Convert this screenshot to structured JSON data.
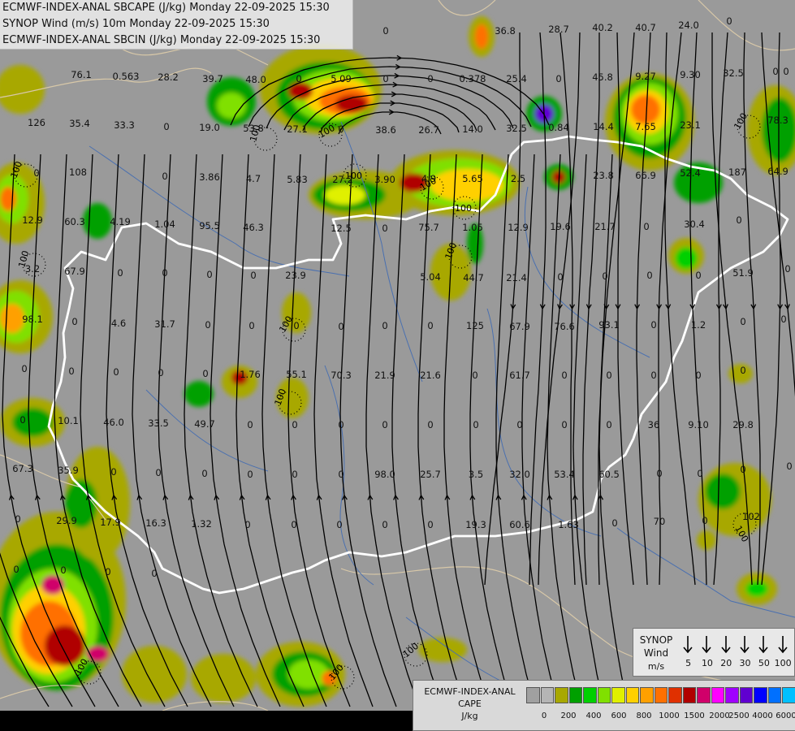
{
  "header": {
    "line1": "ECMWF-INDEX-ANAL SBCAPE (J/kg) Monday 22-09-2025 15:30",
    "line2": "SYNOP Wind (m/s) 10m Monday 22-09-2025 15:30",
    "line3": "ECMWF-INDEX-ANAL SBCIN (J/kg) Monday 22-09-2025 15:30"
  },
  "wind_legend": {
    "title_line1": "SYNOP",
    "title_line2": "Wind",
    "unit": "m/s",
    "values": [
      "5",
      "10",
      "20",
      "30",
      "50",
      "100"
    ]
  },
  "cape_legend": {
    "title_line1": "ECMWF-INDEX-ANAL",
    "title_line2": "CAPE",
    "unit": "J/kg",
    "ticks": [
      "0",
      "200",
      "400",
      "600",
      "800",
      "1000",
      "1500",
      "2000",
      "2500",
      "4000",
      "6000"
    ],
    "colors": [
      "#a0a0a0",
      "#b5b5b5",
      "#a8a800",
      "#00a000",
      "#00d000",
      "#80e000",
      "#e0f000",
      "#ffd000",
      "#ffa000",
      "#ff7000",
      "#e03000",
      "#b00000",
      "#d0006a",
      "#ff00ff",
      "#a000ff",
      "#6000d0",
      "#0000ff",
      "#0070ff",
      "#00c0ff",
      "#60ffff",
      "#ffffff"
    ]
  },
  "map": {
    "colors": {
      "background": "#9a9a9a",
      "border": "#ffffff",
      "province": "#d8c8a8",
      "river": "#4a70b0",
      "streamline": "#000000",
      "cin": "#000000"
    },
    "cin_labels": [
      "100",
      "100",
      "100",
      "100",
      "100",
      "100",
      "100",
      "100",
      "100",
      "100",
      "100",
      "100",
      "100",
      "100",
      "100"
    ],
    "cin_highlight": "100"
  },
  "synop_labels": [
    "0",
    "36.8",
    "28.7",
    "40.2",
    "40.7",
    "24.0",
    "0",
    "0",
    "76.1",
    "0.563",
    "28.2",
    "39.7",
    "48.0",
    "0",
    "5.09",
    "0",
    "0",
    "0.378",
    "25.4",
    "0",
    "45.8",
    "9.27",
    "9.30",
    "32.5",
    "0",
    "126",
    "35.4",
    "33.3",
    "0",
    "19.0",
    "53.8",
    "27.1",
    "0",
    "38.6",
    "26.7",
    "14.0",
    "32.5",
    "0.84",
    "14.4",
    "7.65",
    "23.1",
    "78.3",
    "0",
    "108",
    "0",
    "3.86",
    "4.7",
    "5.83",
    "27.2",
    "3.90",
    "4.9",
    "5.65",
    "2.5",
    "23.8",
    "66.9",
    "52.4",
    "187",
    "64.9",
    "12.9",
    "60.3",
    "4.19",
    "1.04",
    "95.5",
    "46.3",
    "12.5",
    "0",
    "75.7",
    "1.05",
    "12.9",
    "19.6",
    "21.7",
    "0",
    "30.4",
    "0",
    "3.2",
    "67.9",
    "0",
    "0",
    "0",
    "0",
    "23.9",
    "5.04",
    "44.7",
    "21.4",
    "0",
    "0",
    "0",
    "0",
    "51.9",
    "0",
    "98.1",
    "0",
    "4.6",
    "31.7",
    "0",
    "0",
    "0",
    "0",
    "0",
    "0",
    "125",
    "67.9",
    "76.6",
    "93.1",
    "0",
    "1.2",
    "0",
    "0",
    "0",
    "0",
    "0",
    "0",
    "0",
    "1.76",
    "55.1",
    "70.3",
    "21.9",
    "21.6",
    "0",
    "61.7",
    "0",
    "0",
    "0",
    "0",
    "0",
    "0",
    "10.1",
    "46.0",
    "33.5",
    "49.7",
    "0",
    "0",
    "0",
    "0",
    "0",
    "0",
    "0",
    "0",
    "0",
    "36",
    "9.10",
    "29.8",
    "67.3",
    "35.9",
    "0",
    "0",
    "0",
    "0",
    "0",
    "0",
    "98.0",
    "25.7",
    "3.5",
    "32.0",
    "53.4",
    "60.5",
    "0",
    "0",
    "0",
    "0",
    "0",
    "29.9",
    "17.9",
    "16.3",
    "1.32",
    "0",
    "0",
    "0",
    "0",
    "0",
    "19.3",
    "60.6",
    "1.63",
    "0",
    "70",
    "0",
    "102",
    "0",
    "0",
    "0",
    "0"
  ]
}
